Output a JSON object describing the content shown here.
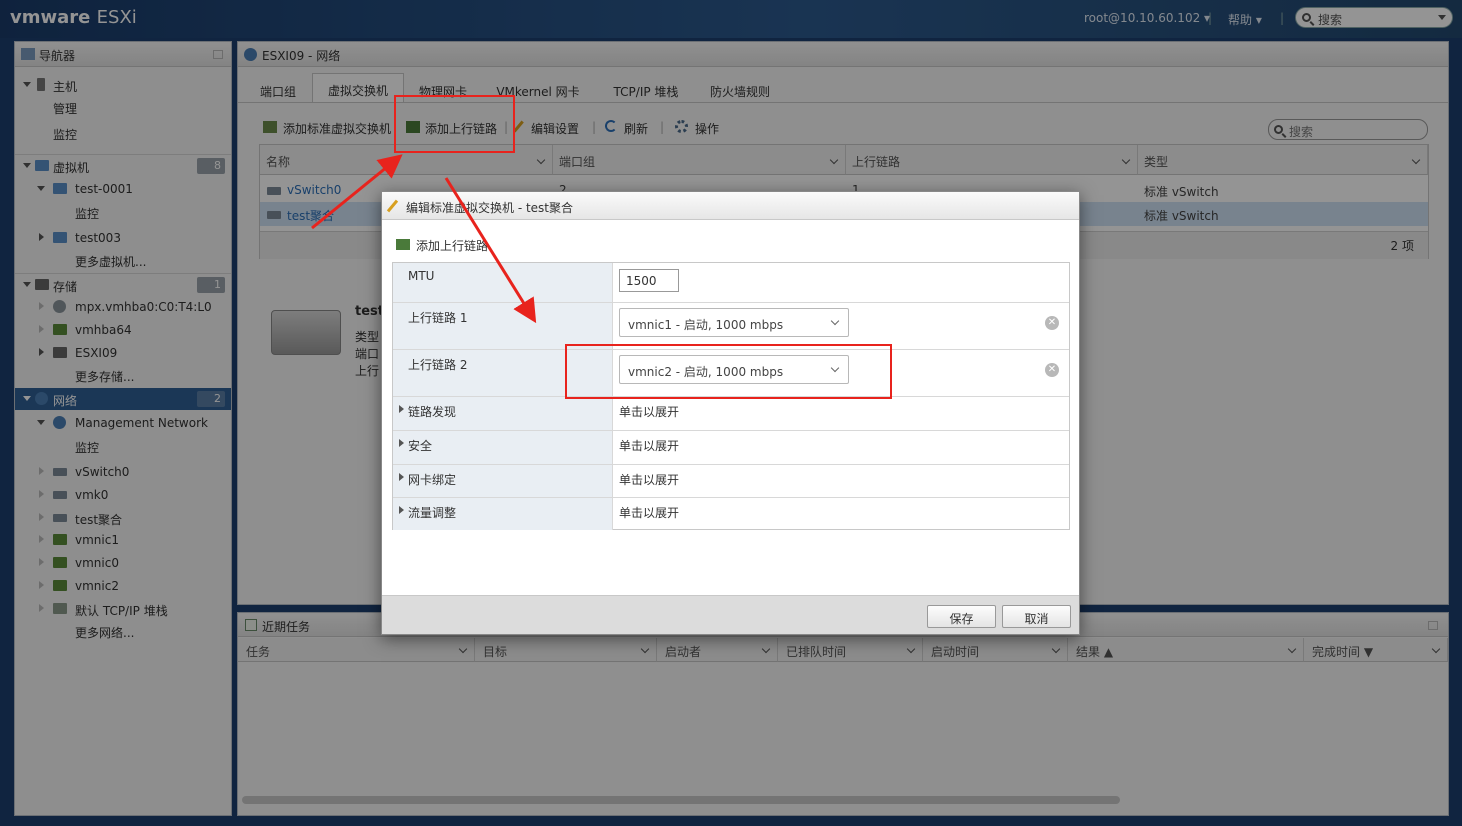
{
  "topbar": {
    "brand": "vmware",
    "product": "ESXi",
    "user": "root@10.10.60.102",
    "help": "帮助",
    "search_placeholder": "搜索"
  },
  "navigator": {
    "title": "导航器",
    "items": [
      {
        "label": "主机"
      },
      {
        "label": "管理"
      },
      {
        "label": "监控"
      },
      {
        "label": "虚拟机",
        "count": "8"
      },
      {
        "label": "test-0001"
      },
      {
        "label": "监控"
      },
      {
        "label": "test003"
      },
      {
        "label": "更多虚拟机..."
      },
      {
        "label": "存储",
        "count": "1"
      },
      {
        "label": "mpx.vmhba0:C0:T4:L0"
      },
      {
        "label": "vmhba64"
      },
      {
        "label": "ESXI09"
      },
      {
        "label": "更多存储..."
      },
      {
        "label": "网络",
        "count": "2"
      },
      {
        "label": "Management Network"
      },
      {
        "label": "监控"
      },
      {
        "label": "vSwitch0"
      },
      {
        "label": "vmk0"
      },
      {
        "label": "test聚合"
      },
      {
        "label": "vmnic1"
      },
      {
        "label": "vmnic0"
      },
      {
        "label": "vmnic2"
      },
      {
        "label": "默认 TCP/IP 堆栈"
      },
      {
        "label": "更多网络..."
      }
    ]
  },
  "main": {
    "title": "ESXI09 - 网络",
    "tabs": [
      "端口组",
      "虚拟交换机",
      "物理网卡",
      "VMkernel 网卡",
      "TCP/IP 堆栈",
      "防火墙规则"
    ],
    "active_tab": "虚拟交换机",
    "toolbar": {
      "add_switch": "添加标准虚拟交换机",
      "add_uplink": "添加上行链路",
      "edit": "编辑设置",
      "refresh": "刷新",
      "actions": "操作",
      "search_placeholder": "搜索"
    },
    "grid": {
      "columns": [
        "名称",
        "端口组",
        "上行链路",
        "类型"
      ],
      "rows": [
        {
          "name": "vSwitch0",
          "portgroups": "2",
          "uplinks": "1",
          "type": "标准 vSwitch"
        },
        {
          "name": "test聚合",
          "portgroups": "",
          "uplinks": "",
          "type": "标准 vSwitch"
        }
      ],
      "footer": "2 项"
    },
    "detail": {
      "name": "test",
      "lines": [
        "类型",
        "端口",
        "上行"
      ]
    }
  },
  "tasks": {
    "title": "近期任务",
    "columns": [
      "任务",
      "目标",
      "启动者",
      "已排队时间",
      "启动时间",
      "结果 ▲",
      "完成时间 ▼"
    ]
  },
  "dialog": {
    "title": "编辑标准虚拟交换机 - test聚合",
    "add_uplink": "添加上行链路",
    "mtu_label": "MTU",
    "mtu_value": "1500",
    "uplink1_label": "上行链路 1",
    "uplink1_value": "vmnic1 - 启动, 1000 mbps",
    "uplink2_label": "上行链路 2",
    "uplink2_value": "vmnic2 - 启动, 1000 mbps",
    "sections": [
      {
        "label": "链路发现",
        "value": "单击以展开"
      },
      {
        "label": "安全",
        "value": "单击以展开"
      },
      {
        "label": "网卡绑定",
        "value": "单击以展开"
      },
      {
        "label": "流量调整",
        "value": "单击以展开"
      }
    ],
    "save": "保存",
    "cancel": "取消"
  },
  "colors": {
    "topbar": "#1a3c6a",
    "selection": "#2f5f95",
    "annotation": "#e8231d"
  }
}
